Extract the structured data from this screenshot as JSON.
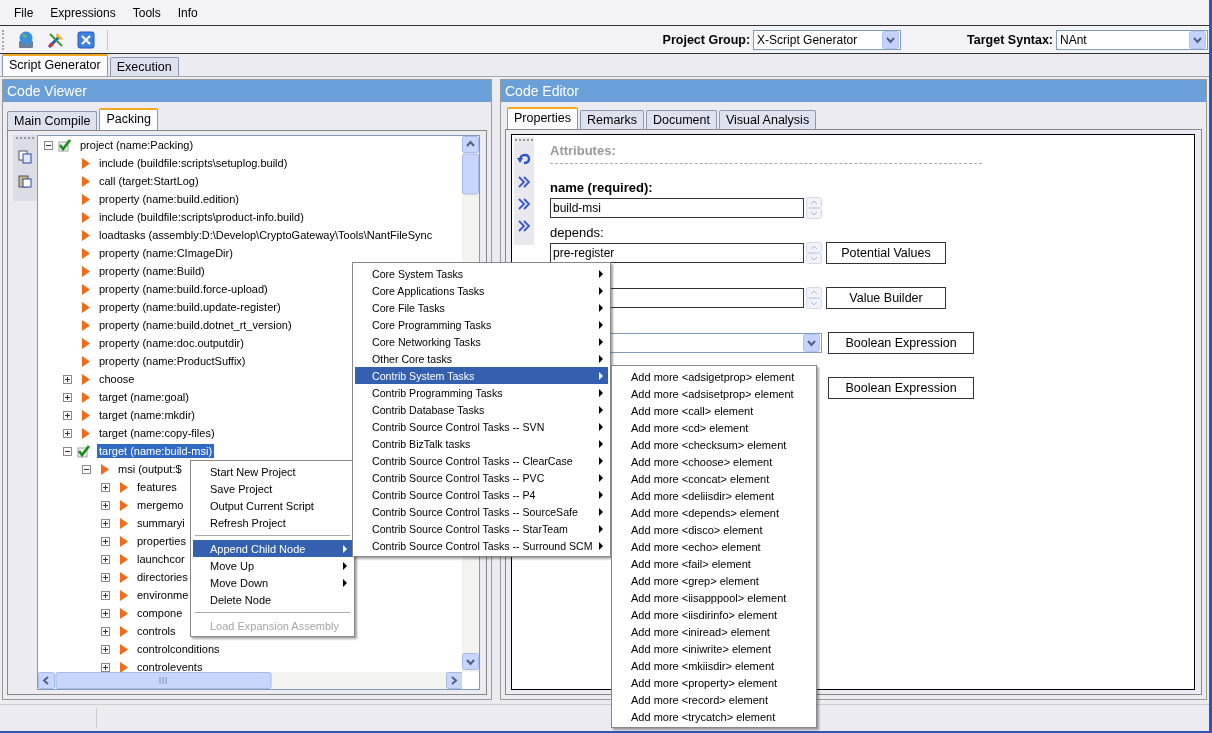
{
  "menubar": [
    "File",
    "Expressions",
    "Tools",
    "Info"
  ],
  "toolbar": {
    "fields": [
      {
        "label": "Project Group:",
        "value": "X-Script Generator"
      },
      {
        "label": "Target Syntax:",
        "value": "NAnt"
      }
    ]
  },
  "main_tabs": [
    {
      "label": "Script Generator",
      "selected": true
    },
    {
      "label": "Execution",
      "selected": false
    }
  ],
  "code_viewer": {
    "title": "Code Viewer",
    "tabs": [
      {
        "label": "Main Compile",
        "selected": false
      },
      {
        "label": "Packing",
        "selected": true
      }
    ],
    "tree": [
      {
        "label": "project (name:Packing)",
        "kind": "branch",
        "expanded": true,
        "checked": true,
        "selected": false,
        "children": [
          {
            "label": "include (buildfile:scripts\\setuplog.build)",
            "kind": "leaf",
            "checked": false,
            "selected": false
          },
          {
            "label": "call (target:StartLog)",
            "kind": "leaf",
            "checked": false,
            "selected": false
          },
          {
            "label": "property (name:build.edition)",
            "kind": "leaf",
            "checked": false,
            "selected": false
          },
          {
            "label": "include (buildfile:scripts\\product-info.build)",
            "kind": "leaf",
            "checked": false,
            "selected": false
          },
          {
            "label": "loadtasks (assembly:D:\\Develop\\CryptoGateway\\Tools\\NantFileSync",
            "kind": "leaf",
            "checked": false,
            "selected": false
          },
          {
            "label": "property (name:CImageDir)",
            "kind": "leaf",
            "checked": false,
            "selected": false
          },
          {
            "label": "property (name:Build)",
            "kind": "leaf",
            "checked": false,
            "selected": false
          },
          {
            "label": "property (name:build.force-upload)",
            "kind": "leaf",
            "checked": false,
            "selected": false
          },
          {
            "label": "property (name:build.update-register)",
            "kind": "leaf",
            "checked": false,
            "selected": false
          },
          {
            "label": "property (name:build.dotnet_rt_version)",
            "kind": "leaf",
            "checked": false,
            "selected": false
          },
          {
            "label": "property (name:doc.outputdir)",
            "kind": "leaf",
            "checked": false,
            "selected": false
          },
          {
            "label": "property (name:ProductSuffix)",
            "kind": "leaf",
            "checked": false,
            "selected": false
          },
          {
            "label": "choose",
            "kind": "branch",
            "expanded": false,
            "checked": false,
            "selected": false
          },
          {
            "label": "target (name:goal)",
            "kind": "branch",
            "expanded": false,
            "checked": false,
            "selected": false
          },
          {
            "label": "target (name:mkdir)",
            "kind": "branch",
            "expanded": false,
            "checked": false,
            "selected": false
          },
          {
            "label": "target (name:copy-files)",
            "kind": "branch",
            "expanded": false,
            "checked": false,
            "selected": false
          },
          {
            "label": "target (name:build-msi)",
            "kind": "branch",
            "expanded": true,
            "checked": true,
            "selected": true,
            "children": [
              {
                "label": "msi (output:$",
                "kind": "branch",
                "expanded": true,
                "checked": false,
                "selected": false,
                "children": [
                  {
                    "label": "features",
                    "kind": "branch",
                    "expanded": false,
                    "checked": false,
                    "selected": false
                  },
                  {
                    "label": "mergemo",
                    "kind": "branch",
                    "expanded": false,
                    "checked": false,
                    "selected": false
                  },
                  {
                    "label": "summaryi",
                    "kind": "branch",
                    "expanded": false,
                    "checked": false,
                    "selected": false
                  },
                  {
                    "label": "properties",
                    "kind": "branch",
                    "expanded": false,
                    "checked": false,
                    "selected": false
                  },
                  {
                    "label": "launchcor",
                    "kind": "branch",
                    "expanded": false,
                    "checked": false,
                    "selected": false
                  },
                  {
                    "label": "directories",
                    "kind": "branch",
                    "expanded": false,
                    "checked": false,
                    "selected": false
                  },
                  {
                    "label": "environme",
                    "kind": "branch",
                    "expanded": false,
                    "checked": false,
                    "selected": false
                  },
                  {
                    "label": "compone",
                    "kind": "branch",
                    "expanded": false,
                    "checked": false,
                    "selected": false
                  },
                  {
                    "label": "controls",
                    "kind": "branch",
                    "expanded": false,
                    "checked": false,
                    "selected": false
                  },
                  {
                    "label": "controlconditions",
                    "kind": "branch",
                    "expanded": false,
                    "checked": false,
                    "selected": false
                  },
                  {
                    "label": "controlevents",
                    "kind": "branch",
                    "expanded": false,
                    "checked": false,
                    "selected": false
                  }
                ]
              }
            ]
          }
        ]
      }
    ]
  },
  "code_editor": {
    "title": "Code Editor",
    "tabs": [
      {
        "label": "Properties",
        "selected": true
      },
      {
        "label": "Remarks",
        "selected": false
      },
      {
        "label": "Document",
        "selected": false
      },
      {
        "label": "Visual Analysis",
        "selected": false
      }
    ],
    "section": "Attributes:",
    "fields": [
      {
        "kind": "text",
        "label": "name (required):",
        "required": true,
        "value": "build-msi"
      },
      {
        "kind": "text",
        "label": "depends:",
        "required": false,
        "value": "pre-register",
        "button": "Potential Values"
      },
      {
        "kind": "text",
        "button": "Value Builder"
      },
      {
        "kind": "select",
        "button": "Boolean Expression"
      },
      {
        "kind": "none",
        "button": "Boolean Expression"
      }
    ]
  },
  "context_menu": {
    "items": [
      {
        "kind": "item",
        "label": "Start New Project",
        "selected": false,
        "submenu": false,
        "disabled": false
      },
      {
        "kind": "item",
        "label": "Save Project",
        "selected": false,
        "submenu": false,
        "disabled": false
      },
      {
        "kind": "item",
        "label": "Output Current Script",
        "selected": false,
        "submenu": false,
        "disabled": false
      },
      {
        "kind": "item",
        "label": "Refresh Project",
        "selected": false,
        "submenu": false,
        "disabled": false
      },
      {
        "kind": "separator"
      },
      {
        "kind": "item",
        "label": "Append Child Node",
        "selected": true,
        "submenu": true,
        "disabled": false
      },
      {
        "kind": "item",
        "label": "Move Up",
        "selected": false,
        "submenu": true,
        "disabled": false
      },
      {
        "kind": "item",
        "label": "Move Down",
        "selected": false,
        "submenu": true,
        "disabled": false
      },
      {
        "kind": "item",
        "label": "Delete Node",
        "selected": false,
        "submenu": false,
        "disabled": false
      },
      {
        "kind": "separator"
      },
      {
        "kind": "item",
        "label": "Load Expansion Assembly",
        "selected": false,
        "submenu": false,
        "disabled": true
      }
    ]
  },
  "submenu": {
    "items": [
      {
        "kind": "item",
        "label": "Core System Tasks",
        "selected": false,
        "submenu": true
      },
      {
        "kind": "item",
        "label": "Core Applications Tasks",
        "selected": false,
        "submenu": true
      },
      {
        "kind": "item",
        "label": "Core File Tasks",
        "selected": false,
        "submenu": true
      },
      {
        "kind": "item",
        "label": "Core Programming Tasks",
        "selected": false,
        "submenu": true
      },
      {
        "kind": "item",
        "label": "Core Networking Tasks",
        "selected": false,
        "submenu": true
      },
      {
        "kind": "item",
        "label": "Other Core tasks",
        "selected": false,
        "submenu": true
      },
      {
        "kind": "item",
        "label": "Contrib System Tasks",
        "selected": true,
        "submenu": true
      },
      {
        "kind": "item",
        "label": "Contrib Programming Tasks",
        "selected": false,
        "submenu": true
      },
      {
        "kind": "item",
        "label": "Contrib Database Tasks",
        "selected": false,
        "submenu": true
      },
      {
        "kind": "item",
        "label": "Contrib Source Control Tasks -- SVN",
        "selected": false,
        "submenu": true
      },
      {
        "kind": "item",
        "label": "Contrib BizTalk tasks",
        "selected": false,
        "submenu": true
      },
      {
        "kind": "item",
        "label": "Contrib Source Control Tasks -- ClearCase",
        "selected": false,
        "submenu": true
      },
      {
        "kind": "item",
        "label": "Contrib Source Control Tasks -- PVC",
        "selected": false,
        "submenu": true
      },
      {
        "kind": "item",
        "label": "Contrib Source Control Tasks -- P4",
        "selected": false,
        "submenu": true
      },
      {
        "kind": "item",
        "label": "Contrib Source Control Tasks -- SourceSafe",
        "selected": false,
        "submenu": true
      },
      {
        "kind": "item",
        "label": "Contrib Source Control Tasks -- StarTeam",
        "selected": false,
        "submenu": true
      },
      {
        "kind": "item",
        "label": "Contrib Source Control Tasks -- Surround SCM",
        "selected": false,
        "submenu": true
      }
    ]
  },
  "submenu_2": {
    "items": [
      {
        "kind": "item",
        "label": "Add more <adsigetprop> element",
        "selected": false
      },
      {
        "kind": "item",
        "label": "Add more <adsisetprop> element",
        "selected": false
      },
      {
        "kind": "item",
        "label": "Add more <call> element",
        "selected": false
      },
      {
        "kind": "item",
        "label": "Add more <cd> element",
        "selected": false
      },
      {
        "kind": "item",
        "label": "Add more <checksum> element",
        "selected": false
      },
      {
        "kind": "item",
        "label": "Add more <choose> element",
        "selected": false
      },
      {
        "kind": "item",
        "label": "Add more <concat> element",
        "selected": false
      },
      {
        "kind": "item",
        "label": "Add more <deliisdir> element",
        "selected": false
      },
      {
        "kind": "item",
        "label": "Add more <depends> element",
        "selected": false
      },
      {
        "kind": "item",
        "label": "Add more <disco> element",
        "selected": false
      },
      {
        "kind": "item",
        "label": "Add more <echo> element",
        "selected": false
      },
      {
        "kind": "item",
        "label": "Add more <fail> element",
        "selected": false
      },
      {
        "kind": "item",
        "label": "Add more <grep> element",
        "selected": false
      },
      {
        "kind": "item",
        "label": "Add more <iisapppool> element",
        "selected": false
      },
      {
        "kind": "item",
        "label": "Add more <iisdirinfo> element",
        "selected": false
      },
      {
        "kind": "item",
        "label": "Add more <iniread> element",
        "selected": false
      },
      {
        "kind": "item",
        "label": "Add more <iniwrite> element",
        "selected": false
      },
      {
        "kind": "item",
        "label": "Add more <mkiisdir> element",
        "selected": false
      },
      {
        "kind": "item",
        "label": "Add more <property> element",
        "selected": false
      },
      {
        "kind": "item",
        "label": "Add more <record> element",
        "selected": false
      },
      {
        "kind": "item",
        "label": "Add more <trycatch> element",
        "selected": false
      }
    ]
  }
}
